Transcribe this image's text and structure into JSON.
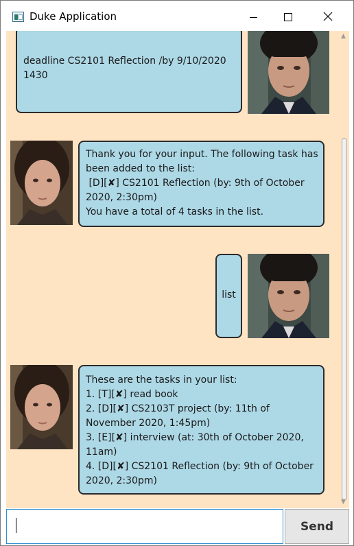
{
  "window": {
    "title": "Duke Application",
    "icon": "app-icon",
    "controls": {
      "minimize": "minimize-icon",
      "maximize": "maximize-icon",
      "close": "close-icon"
    }
  },
  "colors": {
    "background": "#ffe4c4",
    "bubble": "#add8e6",
    "bubble_border": "#2b2b2b",
    "input_focus": "#2f8fcf"
  },
  "dialog": [
    {
      "speaker": "user",
      "lines": [
        "deadline CS2101 Reflection /by 9/10/2020",
        "1430"
      ]
    },
    {
      "speaker": "duke",
      "lines": [
        "Thank you for your input. The following task has",
        "been added to the list:",
        " [D][✘] CS2101 Reflection (by: 9th of October",
        "2020, 2:30pm)",
        "You have a total of 4 tasks in the list."
      ]
    },
    {
      "speaker": "user",
      "lines": [
        "list"
      ]
    },
    {
      "speaker": "duke",
      "lines": [
        "These are the tasks in your list:",
        "1. [T][✘] read book",
        "2. [D][✘] CS2103T project (by: 11th of",
        "November 2020, 1:45pm)",
        "3. [E][✘] interview (at: 30th of October 2020,",
        "11am)",
        "4. [D][✘] CS2101 Reflection (by: 9th of October",
        "2020, 2:30pm)"
      ]
    }
  ],
  "input": {
    "value": "",
    "placeholder": ""
  },
  "send_label": "Send"
}
